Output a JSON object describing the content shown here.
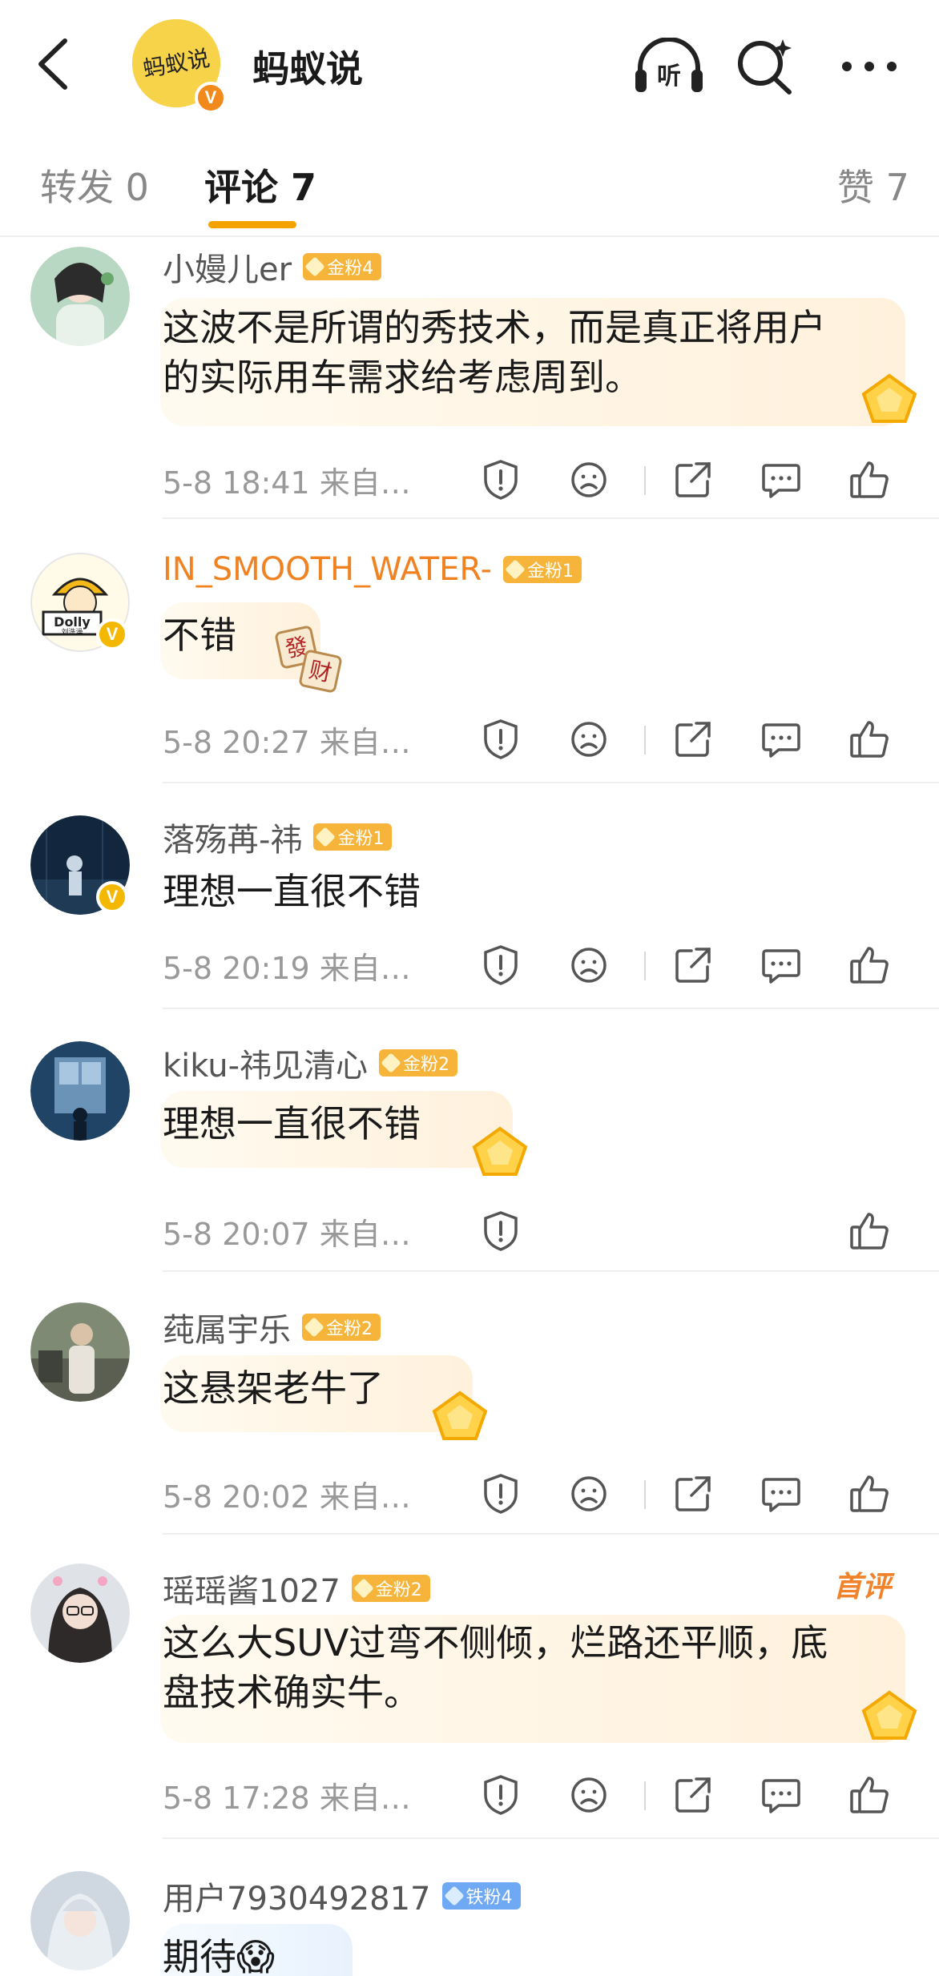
{
  "header": {
    "account_name": "蚂蚁说",
    "avatar_text": "蚂蚁说"
  },
  "tabs": [
    {
      "label": "转发 0"
    },
    {
      "label": "评论 7"
    },
    {
      "label": "赞 7"
    }
  ],
  "comments": [
    {
      "username": "小嫚儿er",
      "badge": "金粉4",
      "text_lines": [
        "这波不是所谓的秀技术，而是真正将用户",
        "的实际用车需求给考虑周到。"
      ],
      "meta": "5-8 18:41  来自…"
    },
    {
      "username": "IN_SMOOTH_WATER-",
      "badge": "金粉1",
      "text_lines": [
        "不错"
      ],
      "meta": "5-8 20:27  来自…",
      "emoji": [
        "發",
        "财"
      ],
      "avatar_label": [
        "Dolly",
        "刘洗澡"
      ]
    },
    {
      "username": "落殇苒-祎",
      "badge": "金粉1",
      "text_lines": [
        "理想一直很不错"
      ],
      "meta": "5-8 20:19  来自…"
    },
    {
      "username": "kiku-祎见清心",
      "badge": "金粉2",
      "text_lines": [
        "理想一直很不错"
      ],
      "meta": "5-8 20:07  来自…"
    },
    {
      "username": "莼属宇乐",
      "badge": "金粉2",
      "text_lines": [
        "这悬架老牛了"
      ],
      "meta": "5-8 20:02  来自…"
    },
    {
      "username": "瑶瑶酱1027",
      "badge": "金粉2",
      "text_lines": [
        "这么大SUV过弯不侧倾，烂路还平顺，底",
        "盘技术确实牛。"
      ],
      "meta": "5-8 17:28  来自…",
      "tag": "首评"
    },
    {
      "username": "用户7930492817",
      "badge": "铁粉4",
      "text_lines": [
        "期待😱"
      ]
    }
  ]
}
